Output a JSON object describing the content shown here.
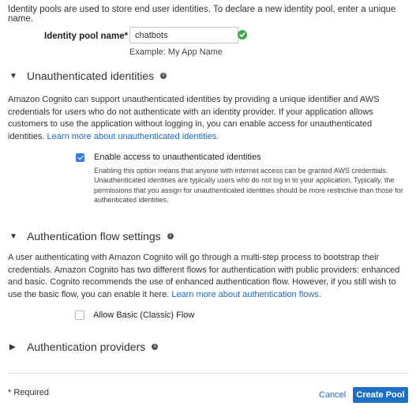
{
  "intro_text": "Identity pools are used to store end user identities. To declare a new identity pool, enter a unique name.",
  "pool_name": {
    "label": "Identity pool name*",
    "value": "chatbots",
    "example": "Example: My App Name"
  },
  "unauth_section": {
    "title": "Unauthenticated identities",
    "description": "Amazon Cognito can support unauthenticated identities by providing a unique identifier and AWS credentials for users who do not authenticate with an identity provider. If your application allows customers to use the application without logging in, you can enable access for unauthenticated identities.",
    "link": "Learn more about unauthenticated identities.",
    "checkbox_label": "Enable access to unauthenticated identities",
    "checkbox_checked": true,
    "help_text": "Enabling this option means that anyone with internet access can be granted AWS credentials. Unauthenticated identities are typically users who do not log in to your application. Typically, the permissions that you assign for unauthenticated identities should be more restrictive than those for authenticated identities."
  },
  "auth_flow_section": {
    "title": "Authentication flow settings",
    "description": "A user authenticating with Amazon Cognito will go through a multi-step process to bootstrap their credentials. Amazon Cognito has two different flows for authentication with public providers: enhanced and basic. Cognito recommends the use of enhanced authentication flow. However, if you still wish to use the basic flow, you can enable it here.",
    "link": "Learn more about authentication flows.",
    "checkbox_label": "Allow Basic (Classic) Flow",
    "checkbox_checked": false
  },
  "auth_providers_section": {
    "title": "Authentication providers"
  },
  "footer": {
    "required_note": "* Required",
    "cancel_label": "Cancel",
    "create_label": "Create Pool"
  },
  "colors": {
    "link": "#2367b7",
    "primary_button": "#1d6fc4",
    "success": "#3aa84b",
    "checkbox": "#3b7dd8"
  }
}
